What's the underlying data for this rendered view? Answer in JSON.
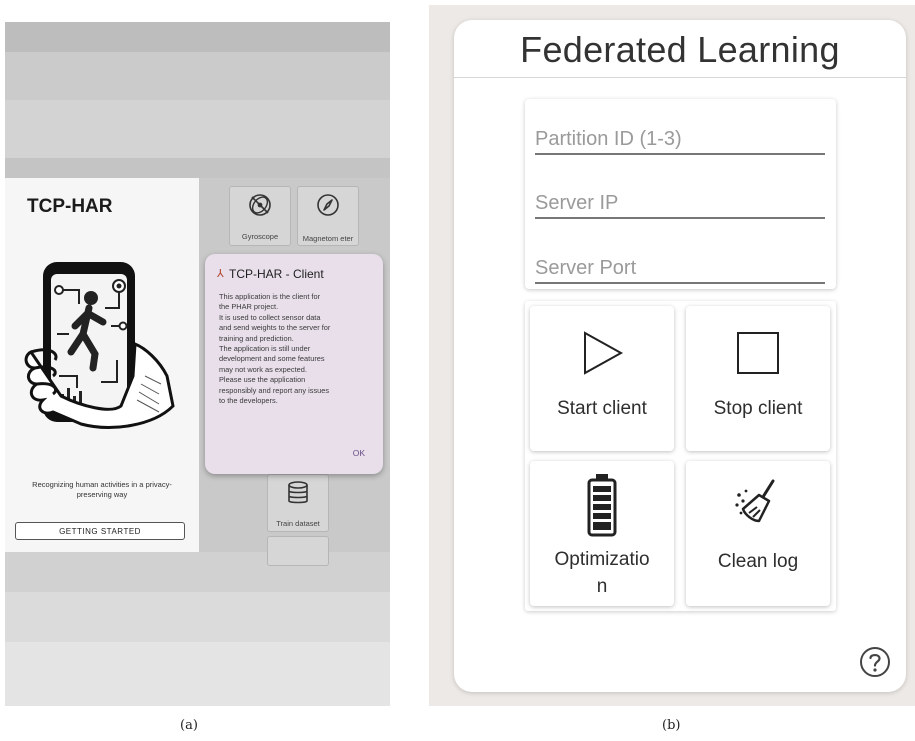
{
  "panel_a": {
    "caption": "(a)",
    "app_title": "TCP-HAR",
    "tagline": "Recognizing human activities in a privacy-preserving way",
    "getting_started_label": "GETTING STARTED",
    "sensors": [
      {
        "label": "Gyroscope",
        "icon": "gyroscope-icon"
      },
      {
        "label": "Magnetom eter",
        "icon": "compass-icon"
      },
      {
        "label": "Train dataset",
        "icon": "database-icon"
      }
    ],
    "dialog": {
      "title": "TCP-HAR  - Client",
      "lines": [
        "This application is the client for",
        "the PHAR project.",
        "It is used to collect sensor data",
        "and send weights to the server for",
        "training and prediction.",
        "The application is still under",
        "development and some features",
        "may not work as expected.",
        "Please use the application",
        "responsibly and report any issues",
        "to the developers."
      ],
      "ok_label": "OK"
    }
  },
  "panel_b": {
    "caption": "(b)",
    "title": "Federated Learning",
    "fields": {
      "partition_placeholder": "Partition ID (1-3)",
      "ip_placeholder": "Server IP",
      "port_placeholder": "Server Port"
    },
    "buttons": {
      "start": "Start client",
      "stop": "Stop client",
      "optimization_line1": "Optimizatio",
      "optimization_line2": "n",
      "clean": "Clean log"
    },
    "help_icon": "help-icon"
  }
}
